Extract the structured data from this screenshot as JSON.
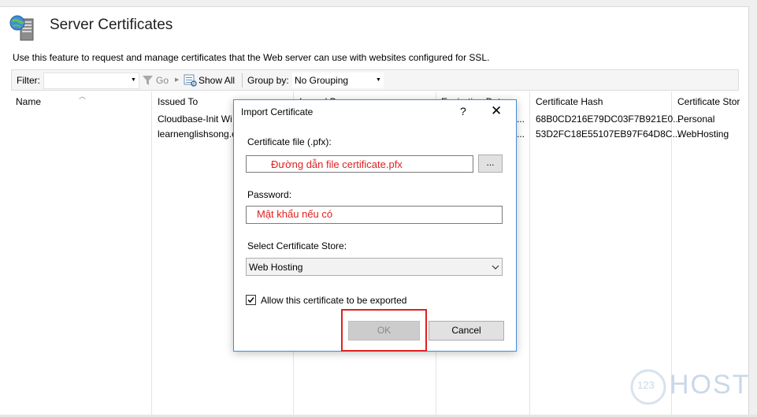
{
  "page": {
    "title": "Server Certificates",
    "description": "Use this feature to request and manage certificates that the Web server can use with websites configured for SSL."
  },
  "toolbar": {
    "filter_label": "Filter:",
    "filter_value": "",
    "go_label": "Go",
    "show_all_label": "Show All",
    "group_by_label": "Group by:",
    "group_by_value": "No Grouping"
  },
  "table": {
    "columns": [
      "Name",
      "Issued To",
      "Issued By",
      "Expiration Date",
      "Certificate Hash",
      "Certificate Store"
    ],
    "columns_visible": [
      "Name",
      "Issued To",
      "Issued B",
      "Expiration Dat",
      "Certificate Hash",
      "Certificate Stor"
    ],
    "rows": [
      {
        "name": "",
        "issued_to": "Cloudbase-Init Wi",
        "issued_by": "",
        "expiration": "...",
        "hash": "68B0CD216E79DC03F7B921E0...",
        "store": "Personal"
      },
      {
        "name": "",
        "issued_to": "learnenglishsong.c",
        "issued_by": "",
        "expiration": "...",
        "hash": "53D2FC18E55107EB97F64D8C...",
        "store": "WebHosting"
      }
    ]
  },
  "dialog": {
    "title": "Import Certificate",
    "help_glyph": "?",
    "close_glyph": "✕",
    "cert_file_label": "Certificate file (.pfx):",
    "cert_file_value": "Đường dẫn file certificate.pfx",
    "browse_label": "...",
    "password_label": "Password:",
    "password_value": "Mật khẩu nếu có",
    "store_label": "Select Certificate Store:",
    "store_value": "Web Hosting",
    "allow_export_label": "Allow this certificate to be exported",
    "allow_export_checked": true,
    "ok_label": "OK",
    "cancel_label": "Cancel"
  },
  "watermark": {
    "badge": "123",
    "text": "HOST"
  },
  "colors": {
    "accent_border": "#4a8bd6",
    "annotation_red": "#e02020"
  }
}
